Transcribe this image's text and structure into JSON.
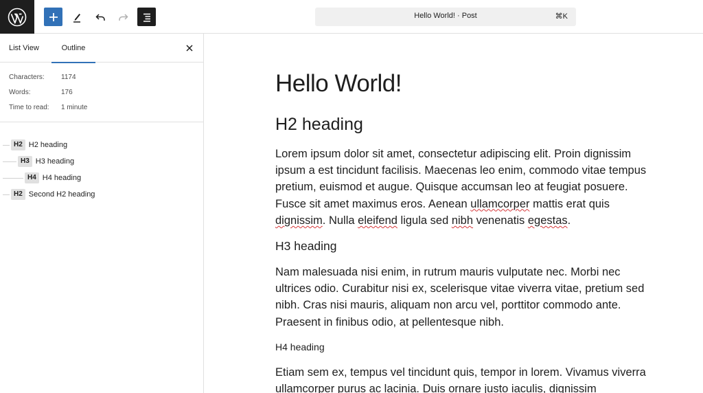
{
  "toolbar": {
    "logo_icon": "wordpress-icon",
    "add_icon": "plus-icon",
    "edit_icon": "pencil-icon",
    "undo_icon": "undo-icon",
    "redo_icon": "redo-icon",
    "outline_icon": "document-overview-icon"
  },
  "command_bar": {
    "title": "Hello World! · Post",
    "shortcut": "⌘K"
  },
  "sidebar": {
    "tabs": [
      {
        "label": "List View",
        "active": false
      },
      {
        "label": "Outline",
        "active": true
      }
    ],
    "close_icon": "close-icon",
    "stats": [
      {
        "label": "Characters:",
        "value": "1174"
      },
      {
        "label": "Words:",
        "value": "176"
      },
      {
        "label": "Time to read:",
        "value": "1 minute"
      }
    ],
    "outline": [
      {
        "level": "H2",
        "text": "H2 heading"
      },
      {
        "level": "H3",
        "text": "H3 heading"
      },
      {
        "level": "H4",
        "text": "H4 heading"
      },
      {
        "level": "H2",
        "text": "Second H2 heading"
      }
    ]
  },
  "post": {
    "title": "Hello World!",
    "h2": "H2 heading",
    "p1_before": "Lorem ipsum dolor sit amet, consectetur adipiscing elit. Proin dignissim ipsum a est tincidunt facilisis. Maecenas leo enim, commodo vitae tempus pretium, euismod et augue. Quisque accumsan leo at feugiat posuere. Fusce sit amet maximus eros. Aenean ",
    "p1_w1": "ullamcorper",
    "p1_mid1": " mattis erat quis ",
    "p1_w2": "dignissim",
    "p1_mid2": ". Nulla ",
    "p1_w3": "eleifend",
    "p1_mid3": " ligula sed ",
    "p1_w4": "nibh",
    "p1_mid4": " venenatis ",
    "p1_w5": "egestas",
    "p1_end": ".",
    "h3": "H3 heading",
    "p2": "Nam malesuada nisi enim, in rutrum mauris vulputate nec. Morbi nec ultrices odio. Curabitur nisi ex, scelerisque vitae viverra vitae, pretium sed nibh. Cras nisi mauris, aliquam non arcu vel, porttitor commodo ante. Praesent in finibus odio, at pellentesque nibh.",
    "h4": "H4 heading",
    "p3_before": "Etiam sem ex, tempus vel tincidunt quis, tempor in lorem. Vivamus viverra ",
    "p3_w1": "ullamcorper",
    "p3_after": " purus ac lacinia. Duis ornare justo iaculis, dignissim"
  },
  "colors": {
    "accent": "#3171b7",
    "dark": "#1e1e1e",
    "spellcheck": "#d63638"
  }
}
